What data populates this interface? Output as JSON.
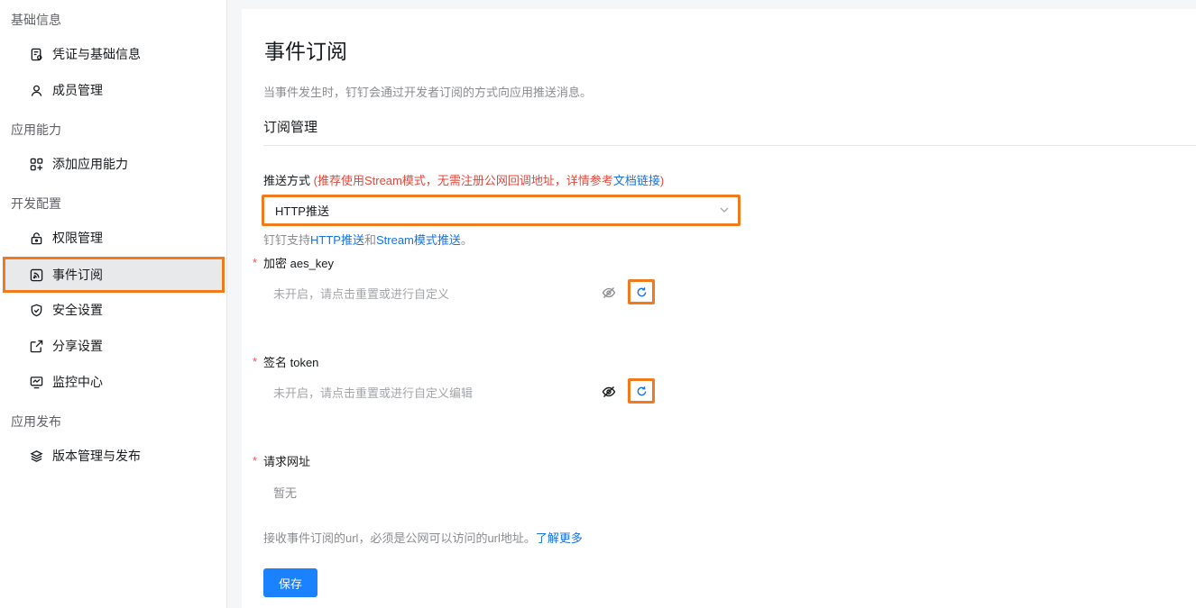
{
  "sidebar": {
    "groups": [
      "基础信息",
      "应用能力",
      "开发配置",
      "应用发布"
    ],
    "items": [
      {
        "label": "凭证与基础信息",
        "icon": "credential-icon"
      },
      {
        "label": "成员管理",
        "icon": "user-icon"
      },
      {
        "label": "添加应用能力",
        "icon": "apps-add-icon"
      },
      {
        "label": "权限管理",
        "icon": "lock-icon"
      },
      {
        "label": "事件订阅",
        "icon": "rss-icon"
      },
      {
        "label": "安全设置",
        "icon": "shield-icon"
      },
      {
        "label": "分享设置",
        "icon": "share-icon"
      },
      {
        "label": "监控中心",
        "icon": "monitor-icon"
      },
      {
        "label": "版本管理与发布",
        "icon": "layers-icon"
      }
    ],
    "active_item": "事件订阅"
  },
  "main": {
    "title": "事件订阅",
    "description": "当事件发生时，钉钉会通过开发者订阅的方式向应用推送消息。",
    "section_title": "订阅管理",
    "push_mode": {
      "label": "推送方式",
      "note_prefix": "(推荐使用Stream模式，无需注册公网回调地址，详情参考",
      "note_link": "文档链接",
      "note_suffix": ")",
      "selected": "HTTP推送",
      "hint_prefix": "钉钉支持",
      "hint_link1": "HTTP推送",
      "hint_mid": "和",
      "hint_link2": "Stream模式推送",
      "hint_suffix": "。"
    },
    "aes_key": {
      "required_mark": "*",
      "label": "加密 aes_key",
      "placeholder": "未开启，请点击重置或进行自定义"
    },
    "token": {
      "required_mark": "*",
      "label": "签名 token",
      "placeholder": "未开启，请点击重置或进行自定义编辑"
    },
    "url": {
      "required_mark": "*",
      "label": "请求网址",
      "value": "暂无",
      "hint": "接收事件订阅的url，必须是公网可以访问的url地址。",
      "hint_link": "了解更多"
    },
    "save_label": "保存"
  },
  "colors": {
    "accent": "#1a82ff",
    "link": "#1672e6",
    "highlight": "#f07a1c",
    "warning": "#e0483c"
  }
}
